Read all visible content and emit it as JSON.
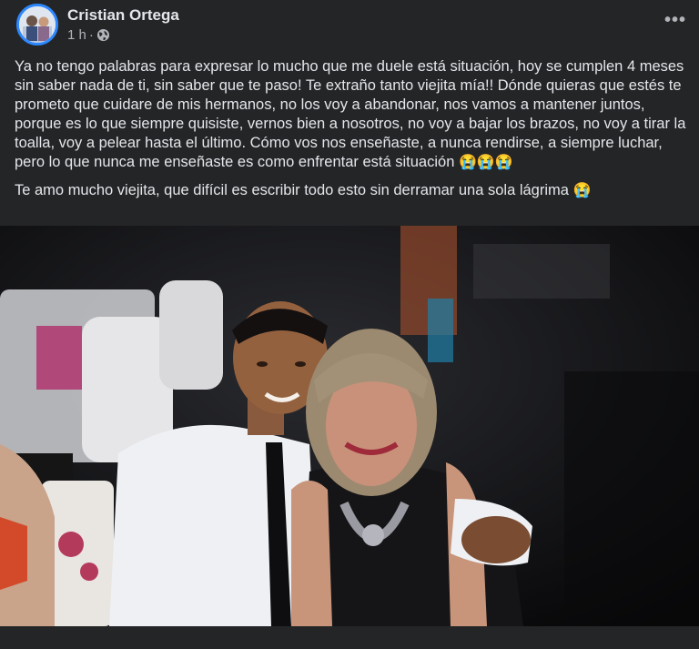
{
  "post": {
    "author": "Cristian Ortega",
    "time": "1 h",
    "separator": "·",
    "privacy_icon": "globe-icon",
    "more_icon": "more-options-icon",
    "more_label": "•••",
    "paragraph1": "Ya no tengo palabras para expresar lo mucho que me duele está situación, hoy se cumplen 4 meses sin saber nada de ti, sin saber que te paso! Te extraño tanto viejita mía!! Dónde quieras que estés te prometo que cuidare de mis hermanos, no los voy a abandonar, nos vamos a mantener juntos, porque es lo que siempre quisiste, vernos bien a nosotros, no voy a bajar los brazos, no voy a tirar la toalla, voy a pelear hasta el último. Cómo vos nos enseñaste, a nunca rendirse, a siempre luchar, pero lo que nunca me enseñaste es como enfrentar está situación",
    "paragraph1_emoji": "😭😭😭",
    "paragraph2": "Te amo mucho viejita, que difícil es escribir todo esto sin derramar una sola lágrima",
    "paragraph2_emoji": "😭"
  },
  "colors": {
    "background": "#242526",
    "text_primary": "#e4e6eb",
    "text_secondary": "#b0b3b8",
    "avatar_ring": "#2d88ff"
  }
}
